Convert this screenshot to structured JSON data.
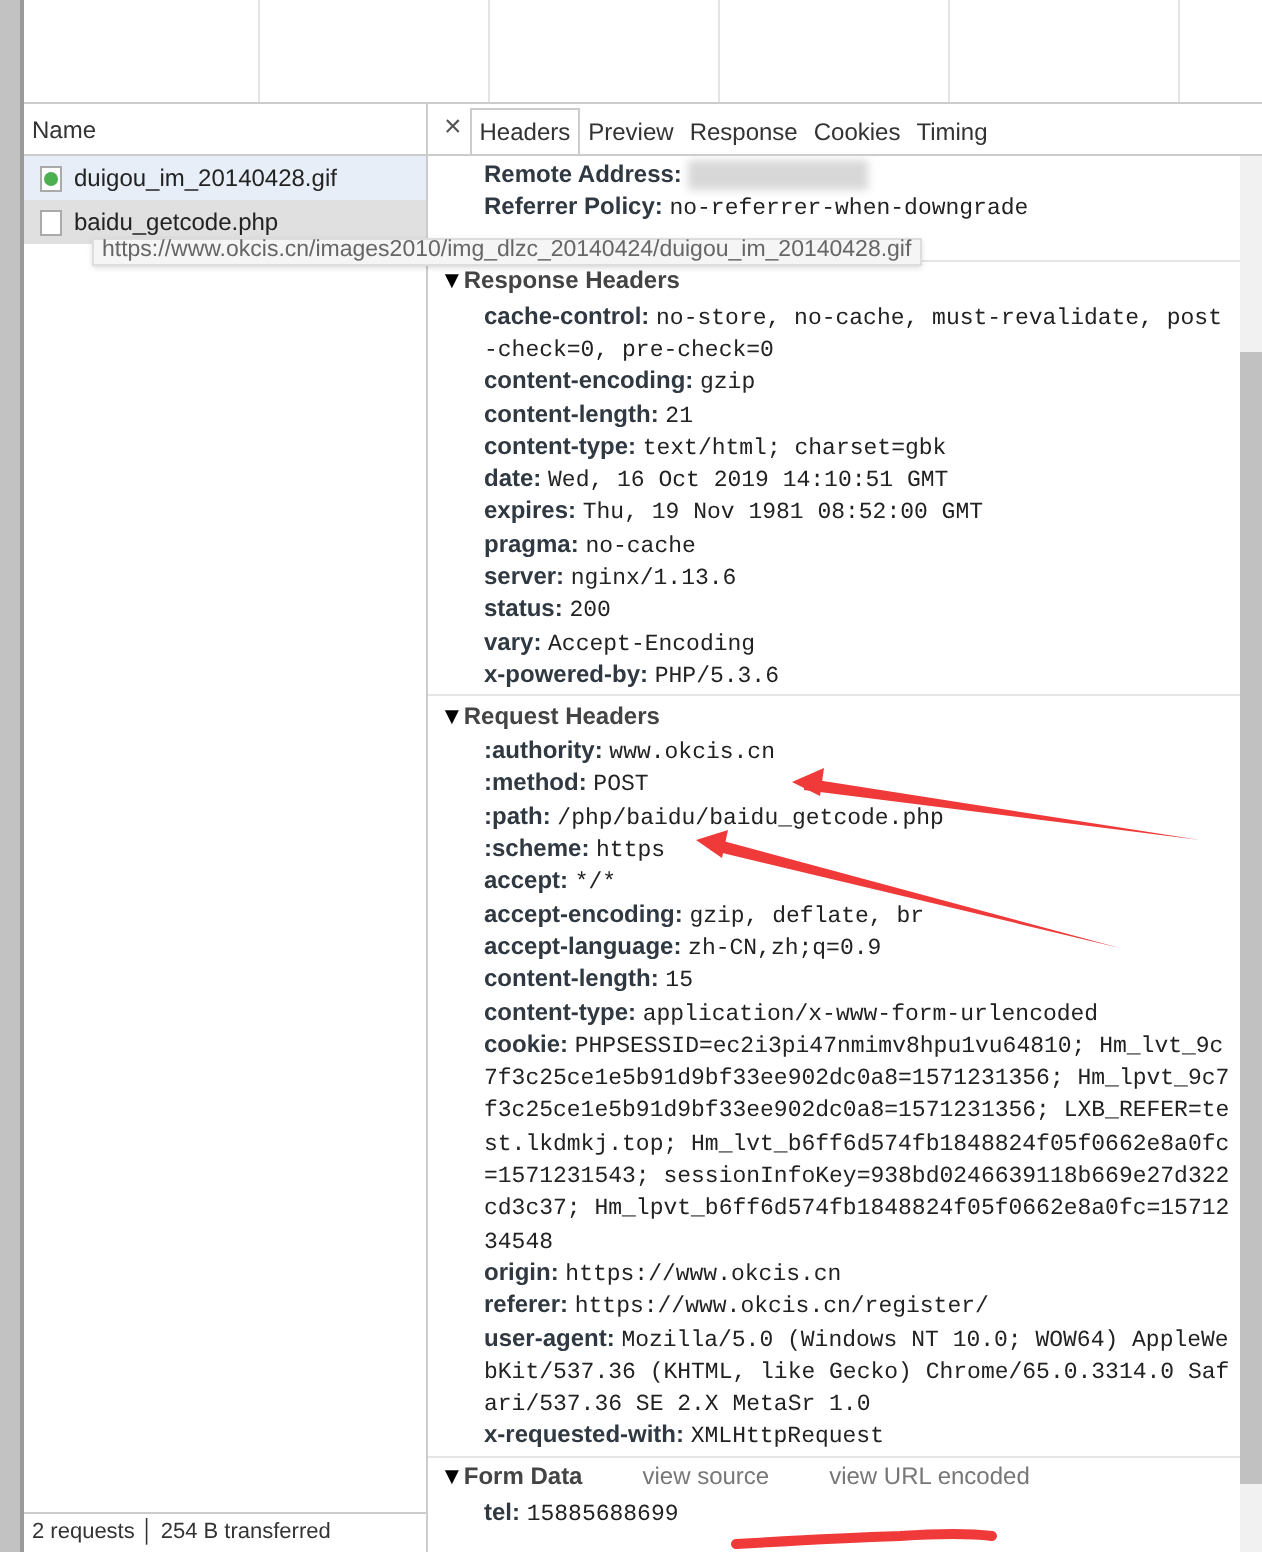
{
  "requests": {
    "column": "Name",
    "items": [
      {
        "name": "duigou_im_20140428.gif",
        "kind": "image",
        "selected": true
      },
      {
        "name": "baidu_getcode.php",
        "kind": "document",
        "selected": false
      }
    ]
  },
  "tooltip": "https://www.okcis.cn/images2010/img_dlzc_20140424/duigou_im_20140428.gif",
  "status_bar": "2 requests │ 254 B transferred",
  "close": "×",
  "tabs": [
    {
      "label": "Headers",
      "selected": true
    },
    {
      "label": "Preview",
      "selected": false
    },
    {
      "label": "Response",
      "selected": false
    },
    {
      "label": "Cookies",
      "selected": false
    },
    {
      "label": "Timing",
      "selected": false
    }
  ],
  "general": [
    {
      "key": "Remote Address:",
      "redacted": true
    },
    {
      "key": "Referrer Policy:",
      "value": "no-referrer-when-downgrade"
    }
  ],
  "sections": [
    {
      "title": "Response Headers",
      "marker": "▼",
      "rows": [
        {
          "key": "cache-control:",
          "value": "no-store, no-cache, must-revalidate, post-check=0, pre-check=0"
        },
        {
          "key": "content-encoding:",
          "value": "gzip"
        },
        {
          "key": "content-length:",
          "value": "21"
        },
        {
          "key": "content-type:",
          "value": "text/html; charset=gbk"
        },
        {
          "key": "date:",
          "value": "Wed, 16 Oct 2019 14:10:51 GMT"
        },
        {
          "key": "expires:",
          "value": "Thu, 19 Nov 1981 08:52:00 GMT"
        },
        {
          "key": "pragma:",
          "value": "no-cache"
        },
        {
          "key": "server:",
          "value": "nginx/1.13.6"
        },
        {
          "key": "status:",
          "value": "200"
        },
        {
          "key": "vary:",
          "value": "Accept-Encoding"
        },
        {
          "key": "x-powered-by:",
          "value": "PHP/5.3.6"
        }
      ]
    },
    {
      "title": "Request Headers",
      "marker": "▼",
      "rows": [
        {
          "key": ":authority:",
          "value": "www.okcis.cn"
        },
        {
          "key": ":method:",
          "value": "POST"
        },
        {
          "key": ":path:",
          "value": "/php/baidu/baidu_getcode.php"
        },
        {
          "key": ":scheme:",
          "value": "https"
        },
        {
          "key": "accept:",
          "value": "*/*"
        },
        {
          "key": "accept-encoding:",
          "value": "gzip, deflate, br"
        },
        {
          "key": "accept-language:",
          "value": "zh-CN,zh;q=0.9"
        },
        {
          "key": "content-length:",
          "value": "15"
        },
        {
          "key": "content-type:",
          "value": "application/x-www-form-urlencoded"
        },
        {
          "key": "cookie:",
          "value": "PHPSESSID=ec2i3pi47nmimv8hpu1vu64810; Hm_lvt_9c7f3c25ce1e5b91d9bf33ee902dc0a8=1571231356; Hm_lpvt_9c7f3c25ce1e5b91d9bf33ee902dc0a8=1571231356; LXB_REFER=test.lkdmkj.top; Hm_lvt_b6ff6d574fb1848824f05f0662e8a0fc=1571231543; sessionInfoKey=938bd0246639118b669e27d322cd3c37; Hm_lpvt_b6ff6d574fb1848824f05f0662e8a0fc=1571234548"
        },
        {
          "key": "origin:",
          "value": "https://www.okcis.cn"
        },
        {
          "key": "referer:",
          "value": "https://www.okcis.cn/register/"
        },
        {
          "key": "user-agent:",
          "value": "Mozilla/5.0 (Windows NT 10.0; WOW64) AppleWebKit/537.36 (KHTML, like Gecko) Chrome/65.0.3314.0 Safari/537.36 SE 2.X MetaSr 1.0"
        },
        {
          "key": "x-requested-with:",
          "value": "XMLHttpRequest"
        }
      ]
    },
    {
      "title": "Form Data",
      "marker": "▼",
      "links": [
        "view source",
        "view URL encoded"
      ],
      "rows": [
        {
          "key": "tel:",
          "value": "15885688699"
        }
      ]
    }
  ]
}
